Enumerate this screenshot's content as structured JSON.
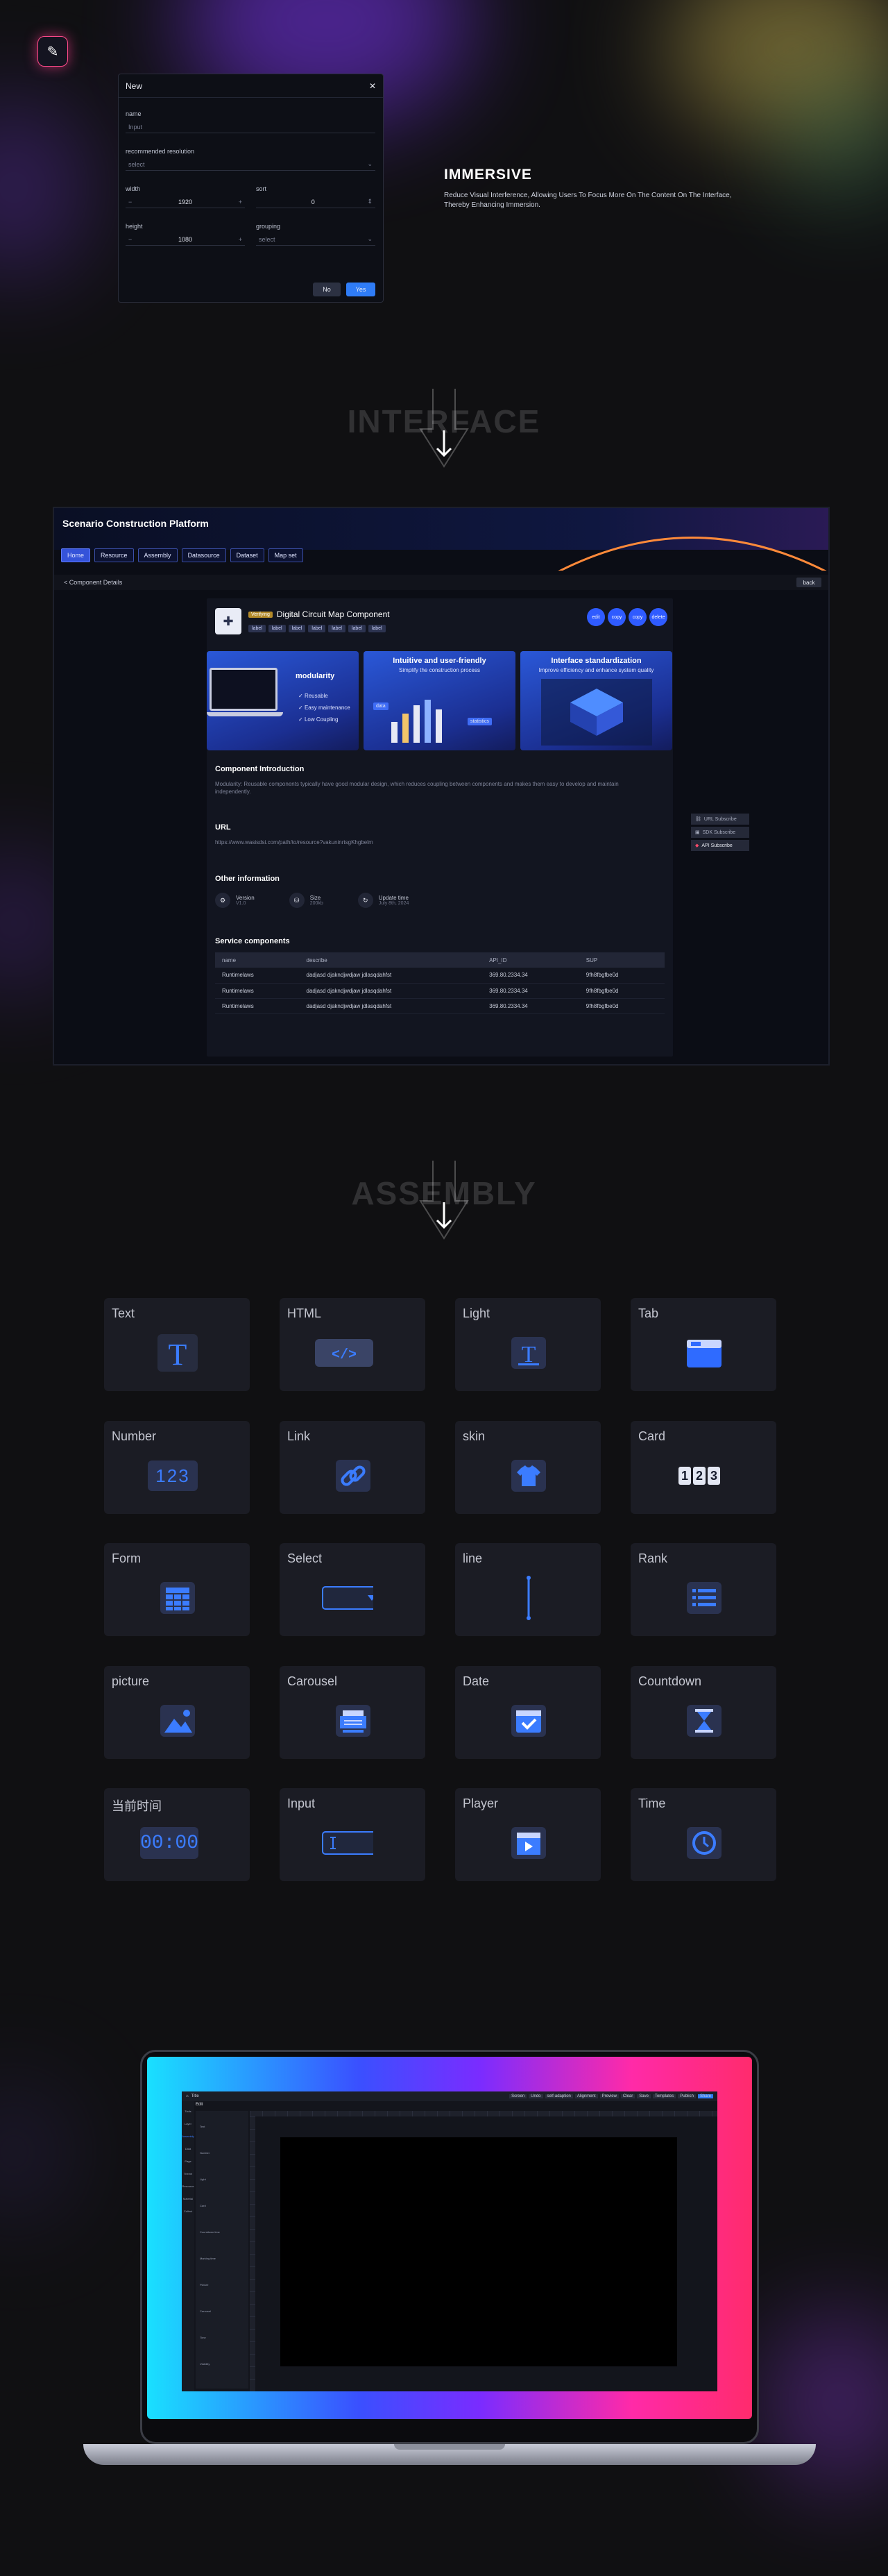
{
  "hero": {
    "dialog": {
      "title": "New",
      "name_label": "name",
      "name_placeholder": "Input",
      "resolution_label": "recommended resolution",
      "resolution_placeholder": "select",
      "width_label": "width",
      "width_value": "1920",
      "sort_label": "sort",
      "sort_value": "0",
      "height_label": "height",
      "height_value": "1080",
      "grouping_label": "grouping",
      "grouping_placeholder": "select",
      "no_label": "No",
      "yes_label": "Yes"
    },
    "immersive_title": "IMMERSIVE",
    "immersive_desc": "Reduce Visual Interference, Allowing Users To Focus More On The Content On The Interface, Thereby Enhancing Immersion."
  },
  "section_interface": "INTERFACE",
  "section_assembly": "ASSEMBLY",
  "platform": {
    "title": "Scenario Construction Platform",
    "nav": [
      "Home",
      "Resource",
      "Assembly",
      "Datasource",
      "Dataset",
      "Map set"
    ],
    "breadcrumb": "< Component Details",
    "back_label": "back",
    "component": {
      "status": "Verifying",
      "title": "Digital Circuit Map Component",
      "tags": [
        "label",
        "label",
        "label",
        "label",
        "label",
        "label",
        "label"
      ],
      "actions": [
        "edit",
        "copy",
        "copy",
        "delete"
      ],
      "features": [
        {
          "title": "modularity",
          "items": [
            "Reusable",
            "Easy maintenance",
            "Low Coupling"
          ]
        },
        {
          "title": "Intuitive and user-friendly",
          "subtitle": "Simplify the construction process",
          "chips": [
            "data",
            "statistics"
          ]
        },
        {
          "title": "Interface standardization",
          "subtitle": "Improve efficiency and enhance system quality"
        }
      ],
      "intro_heading": "Component Introduction",
      "intro_text": "Modularity: Reusable components typically have good modular design, which reduces coupling between components and makes them easy to develop and maintain independently.",
      "url_heading": "URL",
      "url_text": "https://www.wasisdsi.com/path/to/resource?vakuninrtsgKhgbelm",
      "other_heading": "Other information",
      "info": [
        {
          "label": "Version",
          "value": "V1.0"
        },
        {
          "label": "Size",
          "value": "200kb"
        },
        {
          "label": "Update time",
          "value": "July 8th, 2024"
        }
      ],
      "service_heading": "Service components",
      "service_columns": [
        "name",
        "describe",
        "API_ID",
        "SUP"
      ],
      "service_rows": [
        [
          "Runtimelaws",
          "dadjasd djakndjwdjaw jdlasqdahfst",
          "369.80.2334.34",
          "9fh8fbgfbe0d"
        ],
        [
          "Runtimelaws",
          "dadjasd djakndjwdjaw jdlasqdahfst",
          "369.80.2334.34",
          "9fh8fbgfbe0d"
        ],
        [
          "Runtimelaws",
          "dadjasd djakndjwdjaw jdlasqdahfst",
          "369.80.2334.34",
          "9fh8fbgfbe0d"
        ]
      ],
      "side_actions": [
        "URL Subscribe",
        "SDK Subscribe",
        "API Subscribe"
      ]
    }
  },
  "assembly": [
    {
      "label": "Text",
      "icon": "text-icon"
    },
    {
      "label": "HTML",
      "icon": "code-icon"
    },
    {
      "label": "Light",
      "icon": "light-text-icon"
    },
    {
      "label": "Tab",
      "icon": "tab-icon"
    },
    {
      "label": "Number",
      "icon": "number-icon",
      "glyph": "123"
    },
    {
      "label": "Link",
      "icon": "link-icon"
    },
    {
      "label": "skin",
      "icon": "shirt-icon"
    },
    {
      "label": "Card",
      "icon": "card-icon",
      "glyph": "123"
    },
    {
      "label": "Form",
      "icon": "form-icon"
    },
    {
      "label": "Select",
      "icon": "select-icon"
    },
    {
      "label": "line",
      "icon": "line-icon"
    },
    {
      "label": "Rank",
      "icon": "rank-icon"
    },
    {
      "label": "picture",
      "icon": "picture-icon"
    },
    {
      "label": "Carousel",
      "icon": "carousel-icon"
    },
    {
      "label": "Date",
      "icon": "calendar-icon"
    },
    {
      "label": "Countdown",
      "icon": "hourglass-icon"
    },
    {
      "label": "当前时间",
      "icon": "clock-digits-icon",
      "glyph": "00:00"
    },
    {
      "label": "Input",
      "icon": "input-icon"
    },
    {
      "label": "Player",
      "icon": "player-icon"
    },
    {
      "label": "Time",
      "icon": "clock-icon"
    }
  ],
  "editor": {
    "title": "Title",
    "tab": "Edit",
    "sidebar": [
      "Tools",
      "Layer",
      "Assembly",
      "Data",
      "Page",
      "Theme",
      "Resource",
      "Material",
      "Collect"
    ],
    "toolbar": [
      "Screen",
      "Undo",
      "self-adaption",
      "Alignment",
      "Preview",
      "Clear",
      "Save",
      "Templates",
      "Publish",
      "Share"
    ],
    "panel_sections": [
      "Text",
      "Number",
      "Light",
      "Card",
      "Countdown time",
      "Marking time",
      "Picture",
      "Carousel",
      "Time",
      "Visibility"
    ]
  },
  "colors": {
    "accent": "#2f7cf6",
    "brand_blue": "#3553d9",
    "bg": "#101012",
    "card": "#1b1c24"
  }
}
